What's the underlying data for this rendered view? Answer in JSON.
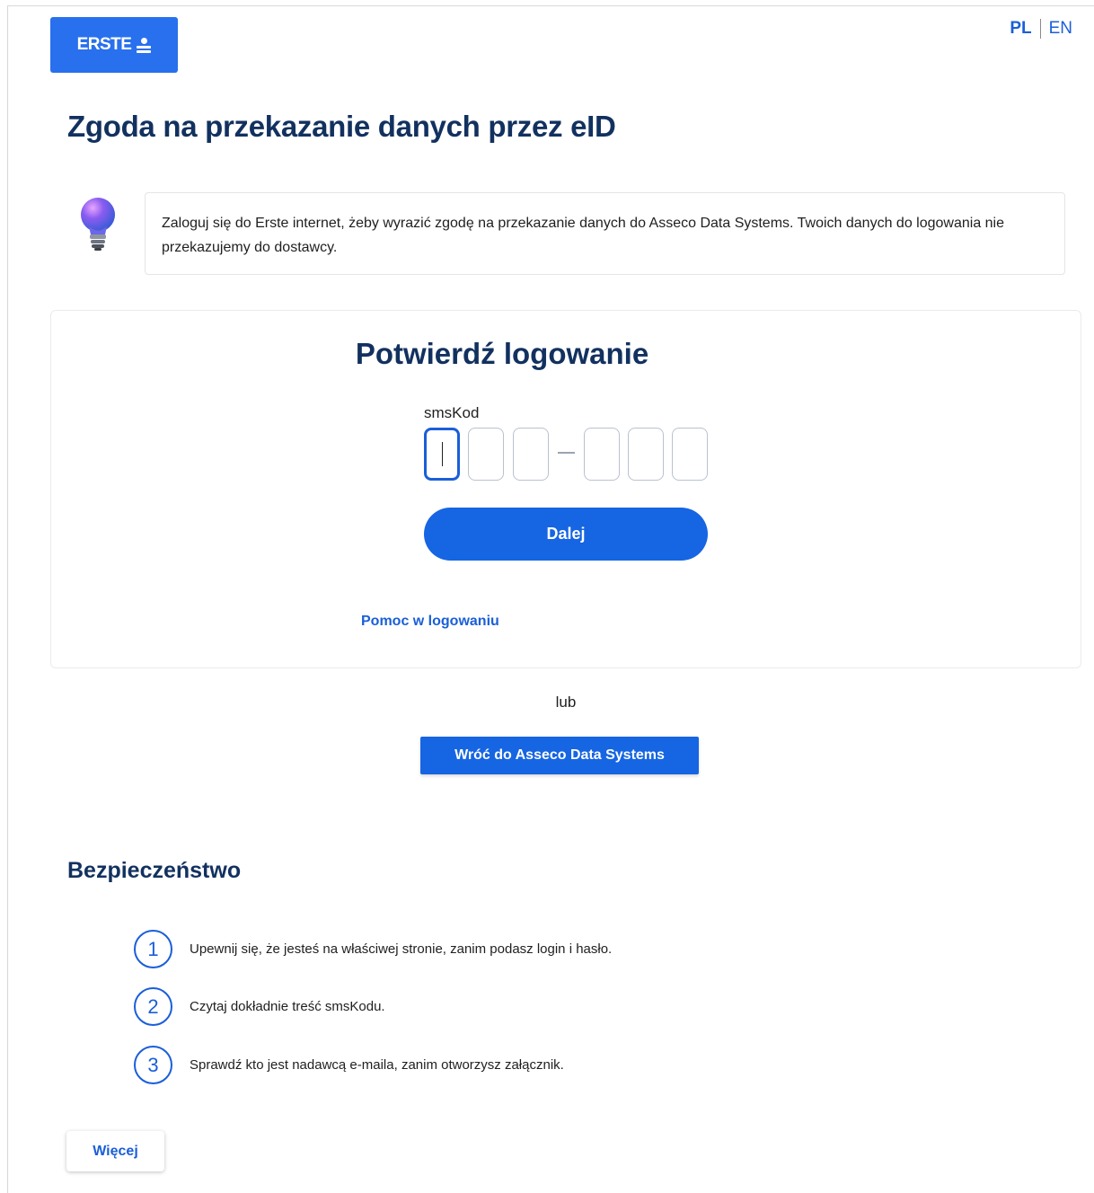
{
  "header": {
    "logo_text": "ERSTE",
    "lang_pl": "PL",
    "lang_en": "EN"
  },
  "page_title": "Zgoda na przekazanie danych przez eID",
  "info": {
    "icon": "lightbulb-icon",
    "text": "Zaloguj się do Erste internet, żeby wyrazić zgodę na przekazanie danych do Asseco Data Systems. Twoich danych do logowania nie przekazujemy do dostawcy."
  },
  "login": {
    "title": "Potwierdź logowanie",
    "sms_label": "smsKod",
    "digits": [
      "",
      "",
      "",
      "",
      "",
      ""
    ],
    "submit_label": "Dalej",
    "help_link": "Pomoc w logowaniu"
  },
  "or_text": "lub",
  "back_button": "Wróć do Asseco Data Systems",
  "security": {
    "title": "Bezpieczeństwo",
    "tips": [
      {
        "num": "1",
        "text": "Upewnij się, że jesteś na właściwej stronie, zanim podasz login i hasło."
      },
      {
        "num": "2",
        "text": "Czytaj dokładnie treść smsKodu."
      },
      {
        "num": "3",
        "text": "Sprawdź kto jest nadawcą e-maila, zanim otworzysz załącznik."
      }
    ],
    "more_button": "Więcej"
  },
  "colors": {
    "brand_blue": "#2870ed",
    "primary_button": "#1665e3",
    "heading": "#12315f"
  }
}
